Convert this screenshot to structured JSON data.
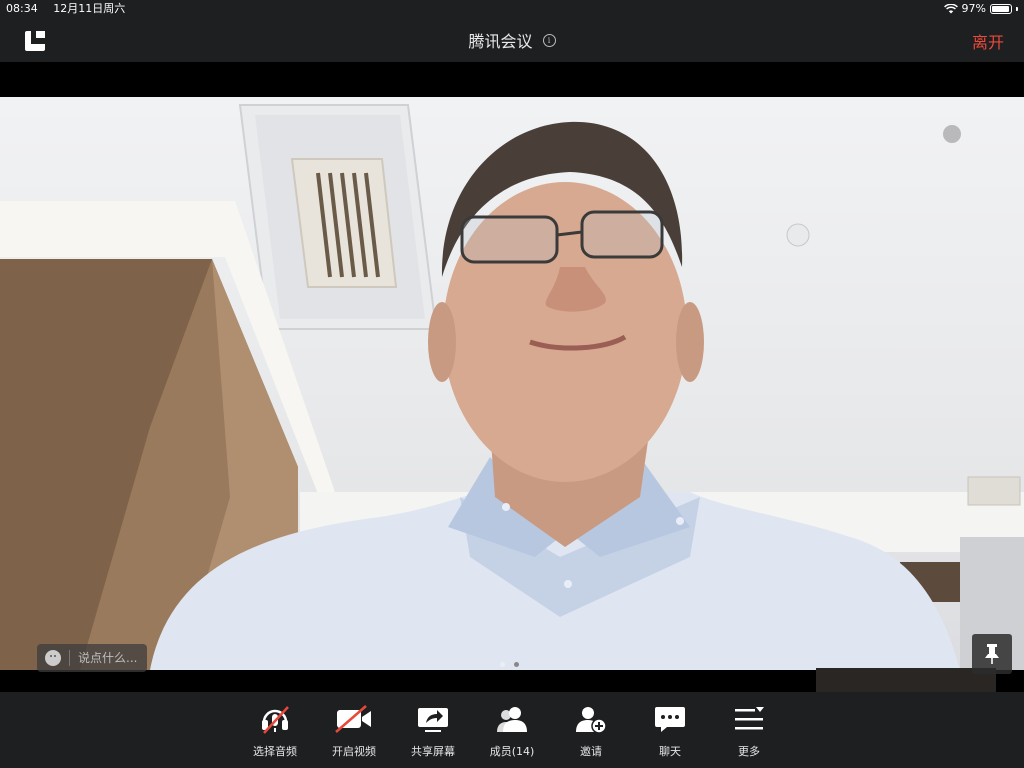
{
  "status_bar": {
    "time": "08:34",
    "date": "12月11日周六",
    "battery": "97%",
    "battery_level": 0.97
  },
  "header": {
    "title": "腾讯会议",
    "info_symbol": "i",
    "leave_label": "离开"
  },
  "video": {
    "chat_placeholder": "说点什么...",
    "page_count": 2,
    "active_page": 1
  },
  "toolbar": {
    "items": [
      {
        "label": "选择音频",
        "icon": "headset-muted-icon"
      },
      {
        "label": "开启视频",
        "icon": "camera-off-icon"
      },
      {
        "label": "共享屏幕",
        "icon": "share-screen-icon"
      },
      {
        "label": "成员(14)",
        "icon": "members-icon"
      },
      {
        "label": "邀请",
        "icon": "invite-icon"
      },
      {
        "label": "聊天",
        "icon": "chat-icon"
      },
      {
        "label": "更多",
        "icon": "more-icon"
      }
    ]
  },
  "colors": {
    "leave": "#ea4a3b",
    "bar_bg": "#1e1f21",
    "mute_slash": "#e8483a"
  }
}
